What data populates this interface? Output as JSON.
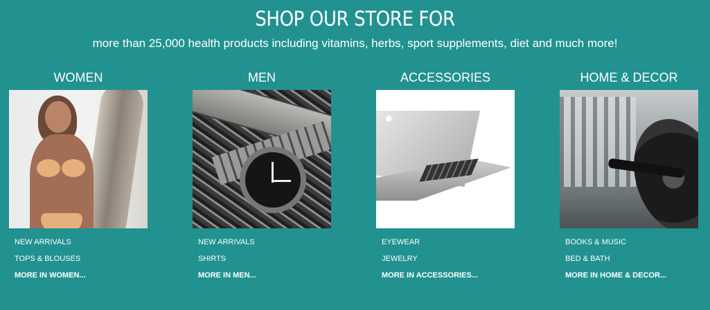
{
  "hero": {
    "title": "SHOP OUR STORE FOR",
    "subtitle": "more than 25,000 health products including vitamins, herbs, sport supplements, diet and much more!"
  },
  "categories": [
    {
      "title": "WOMEN",
      "links": [
        "NEW ARRIVALS",
        "TOPS & BLOUSES"
      ],
      "more": "MORE IN WOMEN..."
    },
    {
      "title": "MEN",
      "links": [
        "NEW ARRIVALS",
        "SHIRTS"
      ],
      "more": "MORE IN MEN..."
    },
    {
      "title": "ACCESSORIES",
      "links": [
        "EYEWEAR",
        "JEWELRY"
      ],
      "more": "MORE IN ACCESSORIES..."
    },
    {
      "title": "HOME & DECOR",
      "links": [
        "BOOKS & MUSIC",
        "BED & BATH"
      ],
      "more": "MORE IN HOME & DECOR..."
    }
  ],
  "colors": {
    "background": "#219290",
    "text": "#ffffff"
  }
}
